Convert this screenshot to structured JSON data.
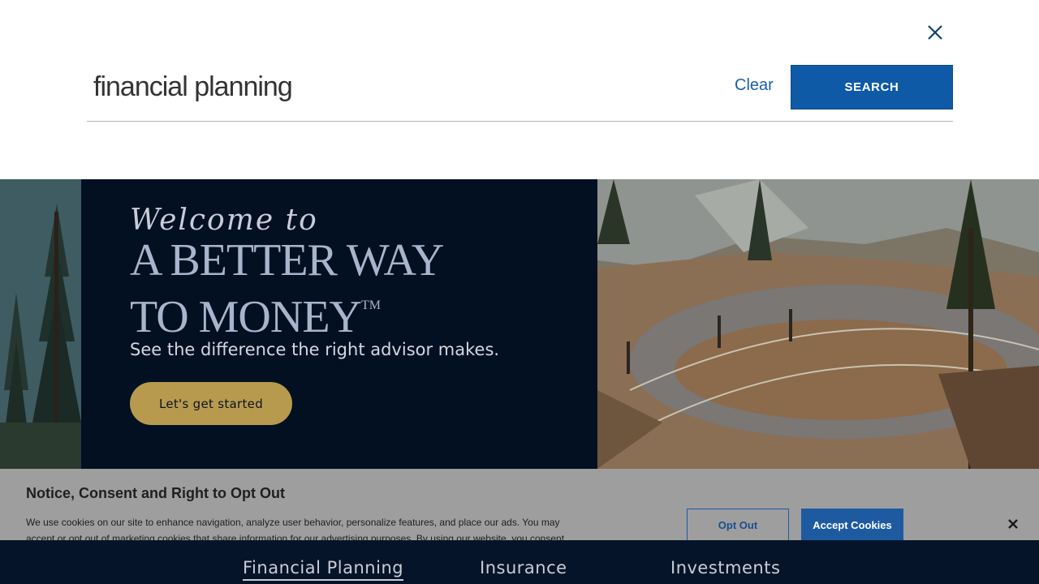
{
  "search": {
    "value": "financial planning",
    "clear_label": "Clear",
    "button_label": "SEARCH"
  },
  "hero": {
    "welcome": "Welcome to",
    "headline_line1": "A BETTER WAY",
    "headline_line2": "TO MONEY",
    "trademark": "TM",
    "subhead": "See the difference the right advisor makes.",
    "cta_label": "Let's get started"
  },
  "cookie": {
    "title": "Notice, Consent and Right to Opt Out",
    "body": "We use cookies on our site to enhance navigation, analyze user behavior, personalize features, and place our ads. You may accept or opt out of marketing cookies that share information for our advertising purposes. By using our website, you consent",
    "opt_out_label": "Opt Out",
    "accept_label": "Accept Cookies"
  },
  "nav": {
    "items": [
      {
        "label": "Financial Planning",
        "active": true
      },
      {
        "label": "Insurance",
        "active": false
      },
      {
        "label": "Investments",
        "active": false
      }
    ]
  },
  "colors": {
    "search_button": "#0e5aa7",
    "clear_link": "#1a5fa8",
    "hero_panel": "#021022",
    "cta": "#b89a4f",
    "cookie_bg": "#9e9e9e",
    "accept_button": "#1e5aa0",
    "nav_bg": "#061429"
  },
  "icons": {
    "search_close": "close-icon",
    "cookie_close": "close-icon"
  }
}
